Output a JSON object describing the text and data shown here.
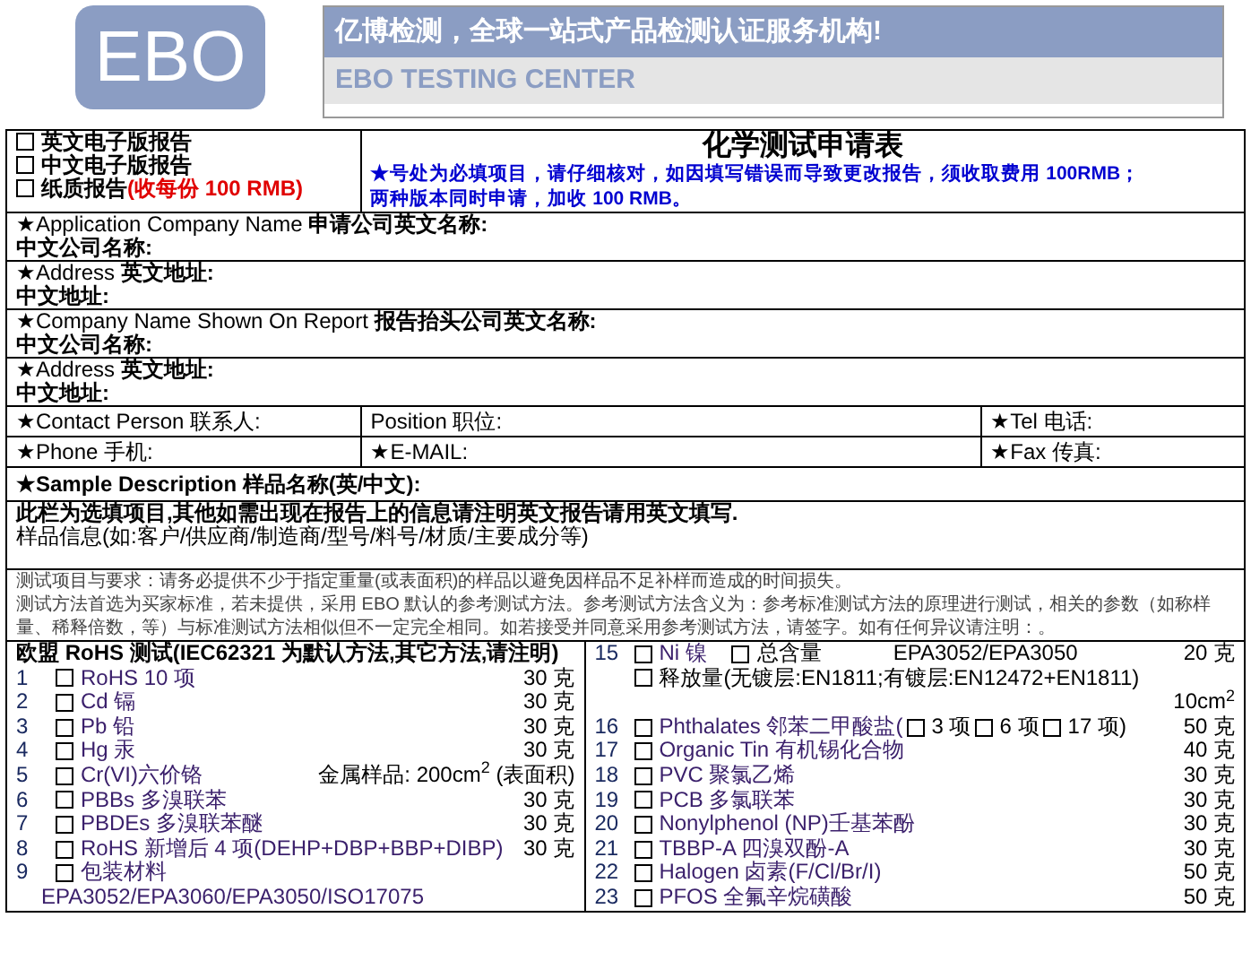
{
  "header": {
    "logo": "EBO",
    "slogan": "亿博检测，全球一站式产品检测认证服务机构!",
    "subtitle": "EBO TESTING CENTER"
  },
  "report_options": [
    {
      "label": "英文电子版报告",
      "checked": false
    },
    {
      "label": "中文电子版报告",
      "checked": false
    },
    {
      "label": "纸质报告",
      "checked": false,
      "price_note": "(收每份 100 RMB)"
    }
  ],
  "form_title": "化学测试申请表",
  "form_notes": [
    "★号处为必填项目，请仔细核对，如因填写错误而导致更改报告，须收取费用 100RMB；",
    "两种版本同时申请，加收 100 RMB。"
  ],
  "company_rows": [
    {
      "label": "★Application Company Name  **申请公司英文名称:**",
      "sub_label": "中文公司名称:"
    },
    {
      "label": "★Address  **英文地址:**",
      "sub_label": "中文地址:"
    },
    {
      "label": "★Company Name Shown On Report  **报告抬头公司英文名称:**",
      "sub_label": "中文公司名称:"
    },
    {
      "label": "★Address **英文地址:**",
      "sub_label": "中文地址:"
    }
  ],
  "contact_rows": [
    [
      "★Contact Person 联系人:",
      "Position 职位:",
      "★Tel 电话:"
    ],
    [
      "★Phone 手机:",
      "★E-MAIL:",
      "★Fax 传真:"
    ]
  ],
  "sample_description": "★Sample Description 样品名称(英/中文):",
  "optional_note": "此栏为选填项目,其他如需出现在报告上的信息请注明英文报告请用英文填写.",
  "sample_info": "样品信息(如:客户/供应商/制造商/型号/料号/材质/主要成分等)",
  "requirements": [
    "测试项目与要求：请务必提供不少于指定重量(或表面积)的样品以避免因样品不足补样而造成的时间损失。",
    "测试方法首选为买家标准，若未提供，采用 EBO 默认的参考测试方法。参考测试方法含义为：参考标准测试方法的原理进行测试，相关的参数（如称样量、稀释倍数，等）与标准测试方法相似但不一定完全相同。如若接受并同意采用参考测试方法，请签字。如有任何异议请注明：。"
  ],
  "tests": {
    "heading": "欧盟 RoHS 测试(IEC62321 为默认方法,其它方法,请注明)",
    "left_items": [
      {
        "number": "1",
        "checked": false,
        "name": "RoHS 10 项",
        "amount": "30 克"
      },
      {
        "number": "2",
        "checked": false,
        "name": "Cd 镉",
        "amount": "30 克"
      },
      {
        "number": "3",
        "checked": false,
        "name": "Pb 铅",
        "amount": "30 克"
      },
      {
        "number": "4",
        "checked": false,
        "name": "Hg 汞",
        "amount": "30 克"
      },
      {
        "number": "5",
        "checked": false,
        "name": "Cr(VI)六价铬",
        "amount": "金属样品: 200cm$^{2}$ (表面积)"
      },
      {
        "number": "6",
        "checked": false,
        "name": "PBBs 多溴联苯",
        "amount": "30 克"
      },
      {
        "number": "7",
        "checked": false,
        "name": "PBDEs 多溴联苯醚",
        "amount": "30 克"
      },
      {
        "number": "8",
        "checked": false,
        "name": "RoHS 新增后 4 项(DEHP+DBP+BBP+DIBP)",
        "amount": "30 克"
      },
      {
        "number": "9",
        "checked": false,
        "name": "包装材料",
        "method": "EPA3052/EPA3060/EPA3050/ISO17075"
      }
    ],
    "right_items": [
      {
        "number": "15",
        "checked": false,
        "name": "Ni 镍",
        "options": [
          {
            "label": "总含量",
            "checked": false
          }
        ],
        "method": "EPA3052/EPA3050",
        "amount": "20 克",
        "sub_option": {
          "label": "释放量(无镀层:EN1811;有镀层:EN12472+EN1811)",
          "checked": false
        },
        "sub_amount": "10cm$^{2}$"
      },
      {
        "number": "16",
        "checked": false,
        "name": "Phthalates 邻苯二甲酸盐(",
        "options": [
          {
            "label": "3 项",
            "checked": false
          },
          {
            "label": "6 项",
            "checked": false
          },
          {
            "label": "17 项)",
            "checked": false
          }
        ],
        "amount": "50 克"
      },
      {
        "number": "17",
        "checked": false,
        "name": "Organic Tin 有机锡化合物",
        "amount": "40 克"
      },
      {
        "number": "18",
        "checked": false,
        "name": "PVC 聚氯乙烯",
        "amount": "30 克"
      },
      {
        "number": "19",
        "checked": false,
        "name": "PCB 多氯联苯",
        "amount": "30 克"
      },
      {
        "number": "20",
        "checked": false,
        "name": "Nonylphenol (NP)壬基苯酚",
        "amount": "30 克"
      },
      {
        "number": "21",
        "checked": false,
        "name": "TBBP-A 四溴双酚-A",
        "amount": "30 克"
      },
      {
        "number": "22",
        "checked": false,
        "name": "Halogen 卤素(F/Cl/Br/I)",
        "amount": "50 克"
      },
      {
        "number": "23",
        "checked": false,
        "name": "PFOS 全氟辛烷磺酸",
        "amount": "50 克"
      }
    ]
  }
}
